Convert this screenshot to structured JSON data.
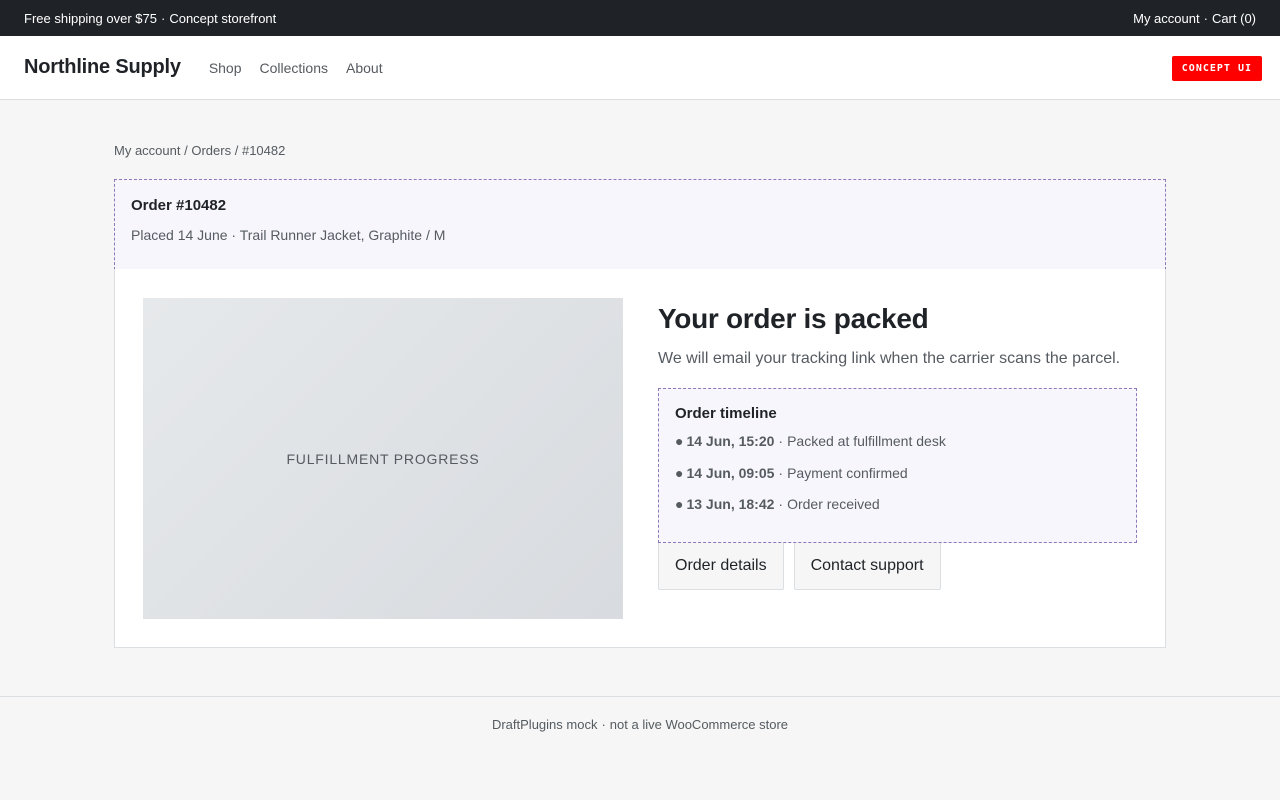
{
  "topbar": {
    "promo_text": "Free shipping over $75",
    "promo_suffix": "Concept storefront",
    "account_link": "My account",
    "cart_link": "Cart (0)"
  },
  "header": {
    "brand": "Northline Supply",
    "nav": [
      "Shop",
      "Collections",
      "About"
    ],
    "badge": "CONCEPT UI"
  },
  "breadcrumb": {
    "items": [
      "My account",
      "Orders",
      "#10482"
    ]
  },
  "order": {
    "title": "Order #10482",
    "placed": "Placed 14 June",
    "item": "Trail Runner Jacket, Graphite / M"
  },
  "progress": {
    "image_label": "FULFILLMENT PROGRESS"
  },
  "status": {
    "title": "Your order is packed",
    "subtitle": "We will email your tracking link when the carrier scans the parcel."
  },
  "timeline": {
    "title": "Order timeline",
    "events": [
      {
        "time": "14 Jun, 15:20",
        "label": "Packed at fulfillment desk"
      },
      {
        "time": "14 Jun, 09:05",
        "label": "Payment confirmed"
      },
      {
        "time": "13 Jun, 18:42",
        "label": "Order received"
      }
    ]
  },
  "actions": {
    "details": "Order details",
    "support": "Contact support"
  },
  "footer": {
    "left": "DraftPlugins mock",
    "right": "not a live WooCommerce store"
  },
  "colors": {
    "topbar": "#1f2327",
    "accent_badge": "#ff0000",
    "highlight_bg": "#f8f6fd",
    "highlight_border": "#8d79b9"
  }
}
